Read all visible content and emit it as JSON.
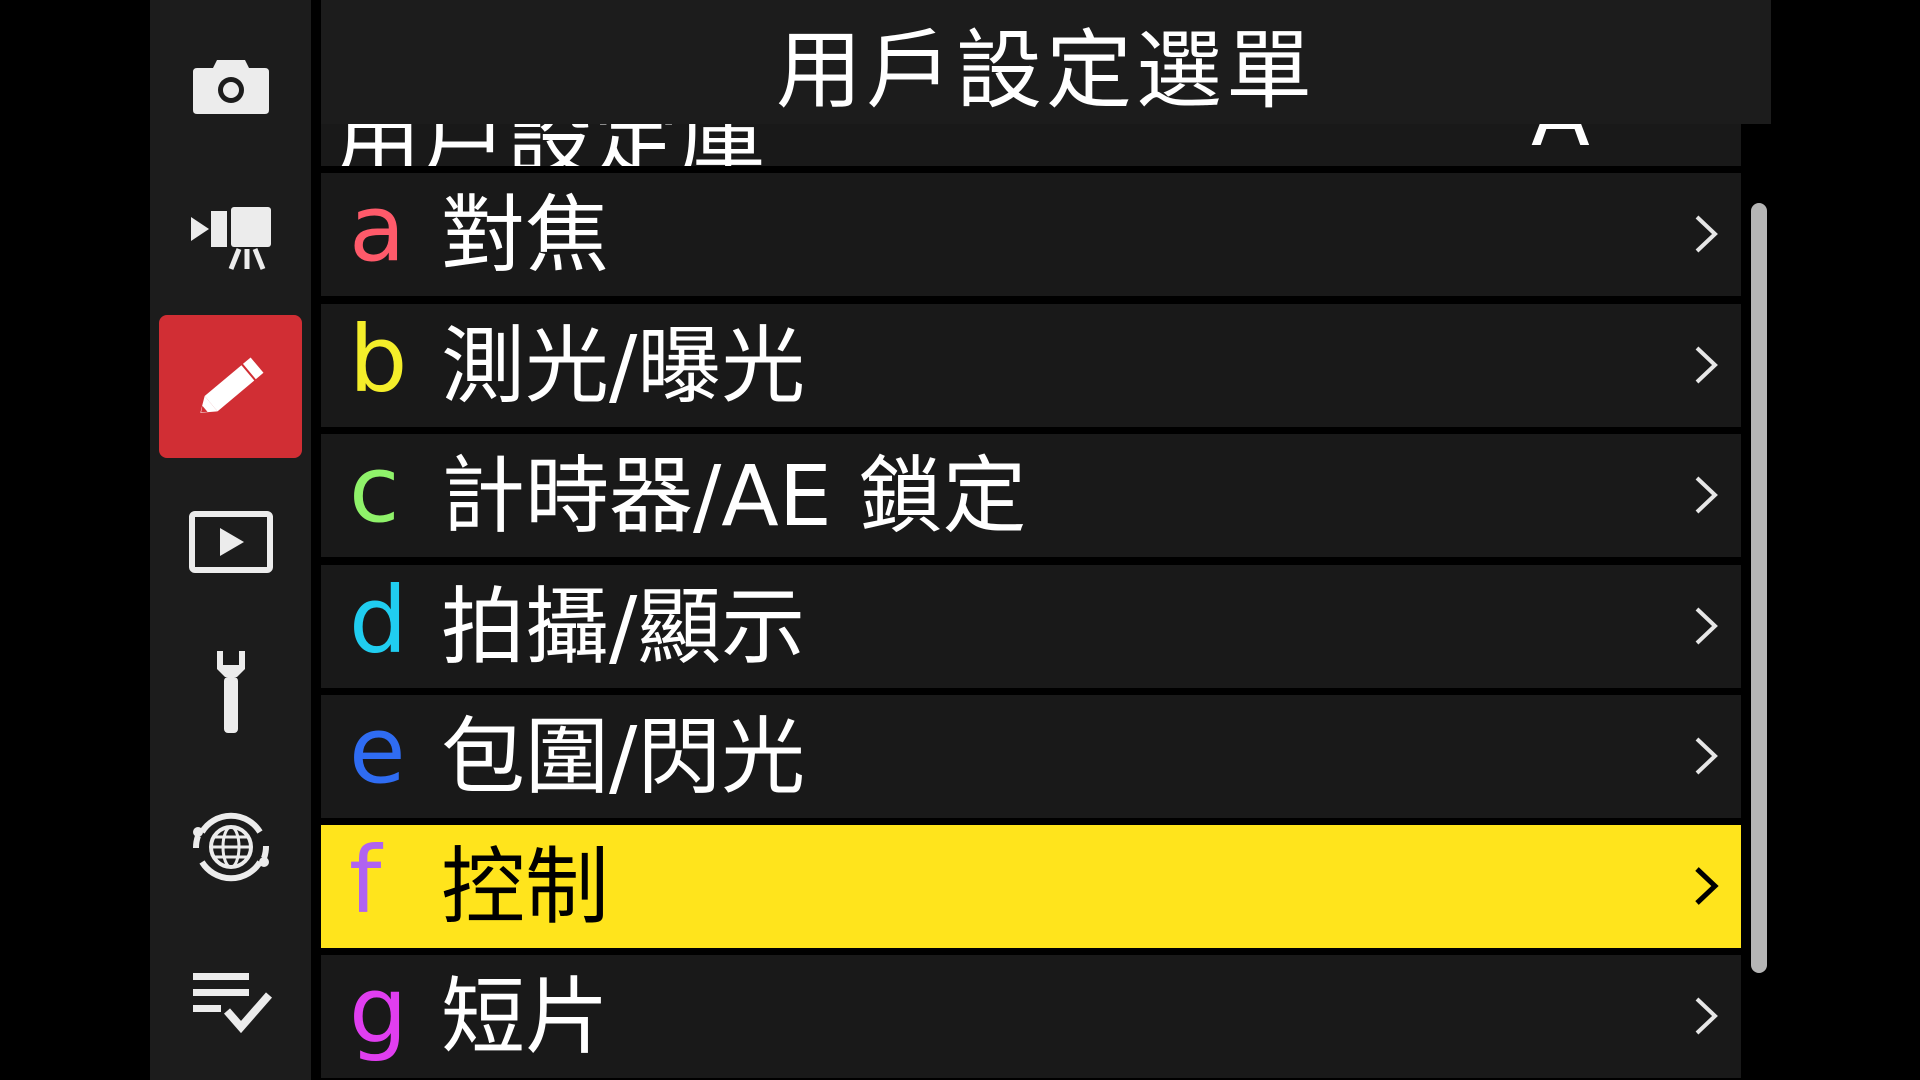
{
  "header": {
    "title": "用戶設定選單"
  },
  "sidebar": {
    "tabs": [
      {
        "icon": "camera-icon",
        "active": false
      },
      {
        "icon": "movie-camera-icon",
        "active": false
      },
      {
        "icon": "pencil-icon",
        "active": true
      },
      {
        "icon": "playback-icon",
        "active": false
      },
      {
        "icon": "wrench-icon",
        "active": false
      },
      {
        "icon": "network-icon",
        "active": false
      },
      {
        "icon": "my-menu-icon",
        "active": false
      }
    ]
  },
  "menu": {
    "partial_item": {
      "label": "用戶設定庫",
      "value": "A"
    },
    "items": [
      {
        "letter": "a",
        "label": "對焦",
        "letter_color": "#ff5a6a"
      },
      {
        "letter": "b",
        "label": "測光/曝光",
        "letter_color": "#f4ee2a"
      },
      {
        "letter": "c",
        "label": "計時器/AE 鎖定",
        "letter_color": "#8ff26a"
      },
      {
        "letter": "d",
        "label": "拍攝/顯示",
        "letter_color": "#20cdf0"
      },
      {
        "letter": "e",
        "label": "包圍/閃光",
        "letter_color": "#2f6cf2"
      },
      {
        "letter": "f",
        "label": "控制",
        "letter_color": "#b062f0",
        "selected": true
      },
      {
        "letter": "g",
        "label": "短片",
        "letter_color": "#e03ef0"
      }
    ]
  },
  "colors": {
    "selection": "#ffe41c",
    "active_tab": "#d12e34",
    "row_bg": "#191919"
  }
}
